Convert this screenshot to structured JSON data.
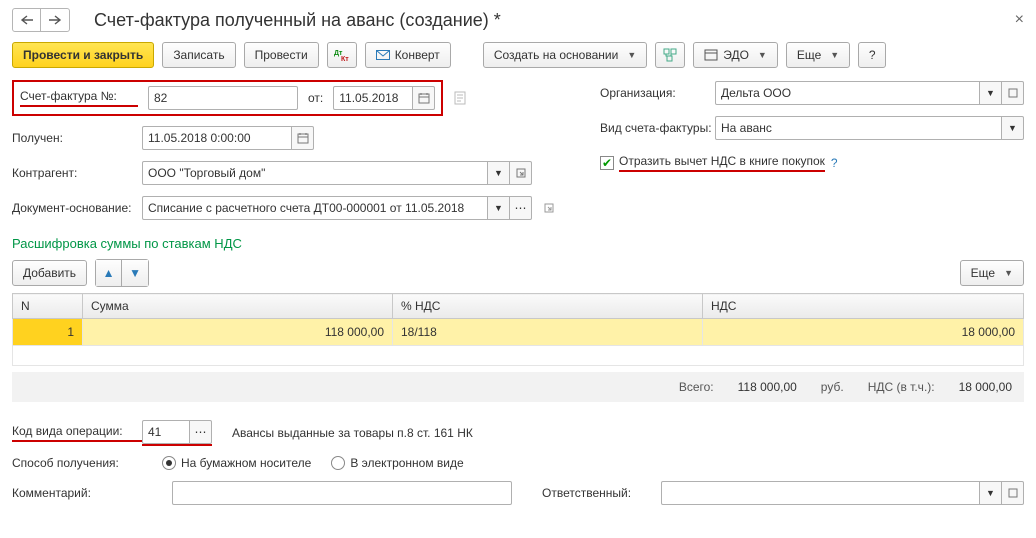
{
  "title": "Счет-фактура полученный на аванс (создание) *",
  "toolbar": {
    "post_close": "Провести и закрыть",
    "save": "Записать",
    "post": "Провести",
    "convert": "Конверт",
    "create_based": "Создать на основании",
    "edo": "ЭДО",
    "more": "Еще",
    "help": "?"
  },
  "labels": {
    "invoice_no": "Счет-фактура №:",
    "from": "от:",
    "received": "Получен:",
    "contractor": "Контрагент:",
    "basis_doc": "Документ-основание:",
    "organization": "Организация:",
    "invoice_type": "Вид счета-фактуры:",
    "vat_deduct": "Отразить вычет НДС в книге покупок",
    "section": "Расшифровка суммы по ставкам НДС",
    "add": "Добавить",
    "more2": "Еще",
    "opcode": "Код вида операции:",
    "opcode_desc": "Авансы выданные за товары п.8 ст. 161 НК",
    "receipt_method": "Способ получения:",
    "paper": "На бумажном носителе",
    "electronic": "В электронном виде",
    "comment": "Комментарий:",
    "responsible": "Ответственный:"
  },
  "values": {
    "invoice_no": "82",
    "invoice_date": "11.05.2018",
    "received": "11.05.2018  0:00:00",
    "contractor": "ООО \"Торговый дом\"",
    "basis_doc": "Списание с расчетного счета ДТ00-000001 от 11.05.2018",
    "organization": "Дельта ООО",
    "invoice_type": "На аванс",
    "opcode": "41",
    "comment": "",
    "responsible": ""
  },
  "table": {
    "cols": {
      "n": "N",
      "sum": "Сумма",
      "rate": "% НДС",
      "vat": "НДС"
    },
    "rows": [
      {
        "n": "1",
        "sum": "118 000,00",
        "rate": "18/118",
        "vat": "18 000,00"
      }
    ]
  },
  "totals": {
    "total_lbl": "Всего:",
    "total_val": "118 000,00",
    "currency": "руб.",
    "vat_lbl": "НДС (в т.ч.):",
    "vat_val": "18 000,00"
  }
}
